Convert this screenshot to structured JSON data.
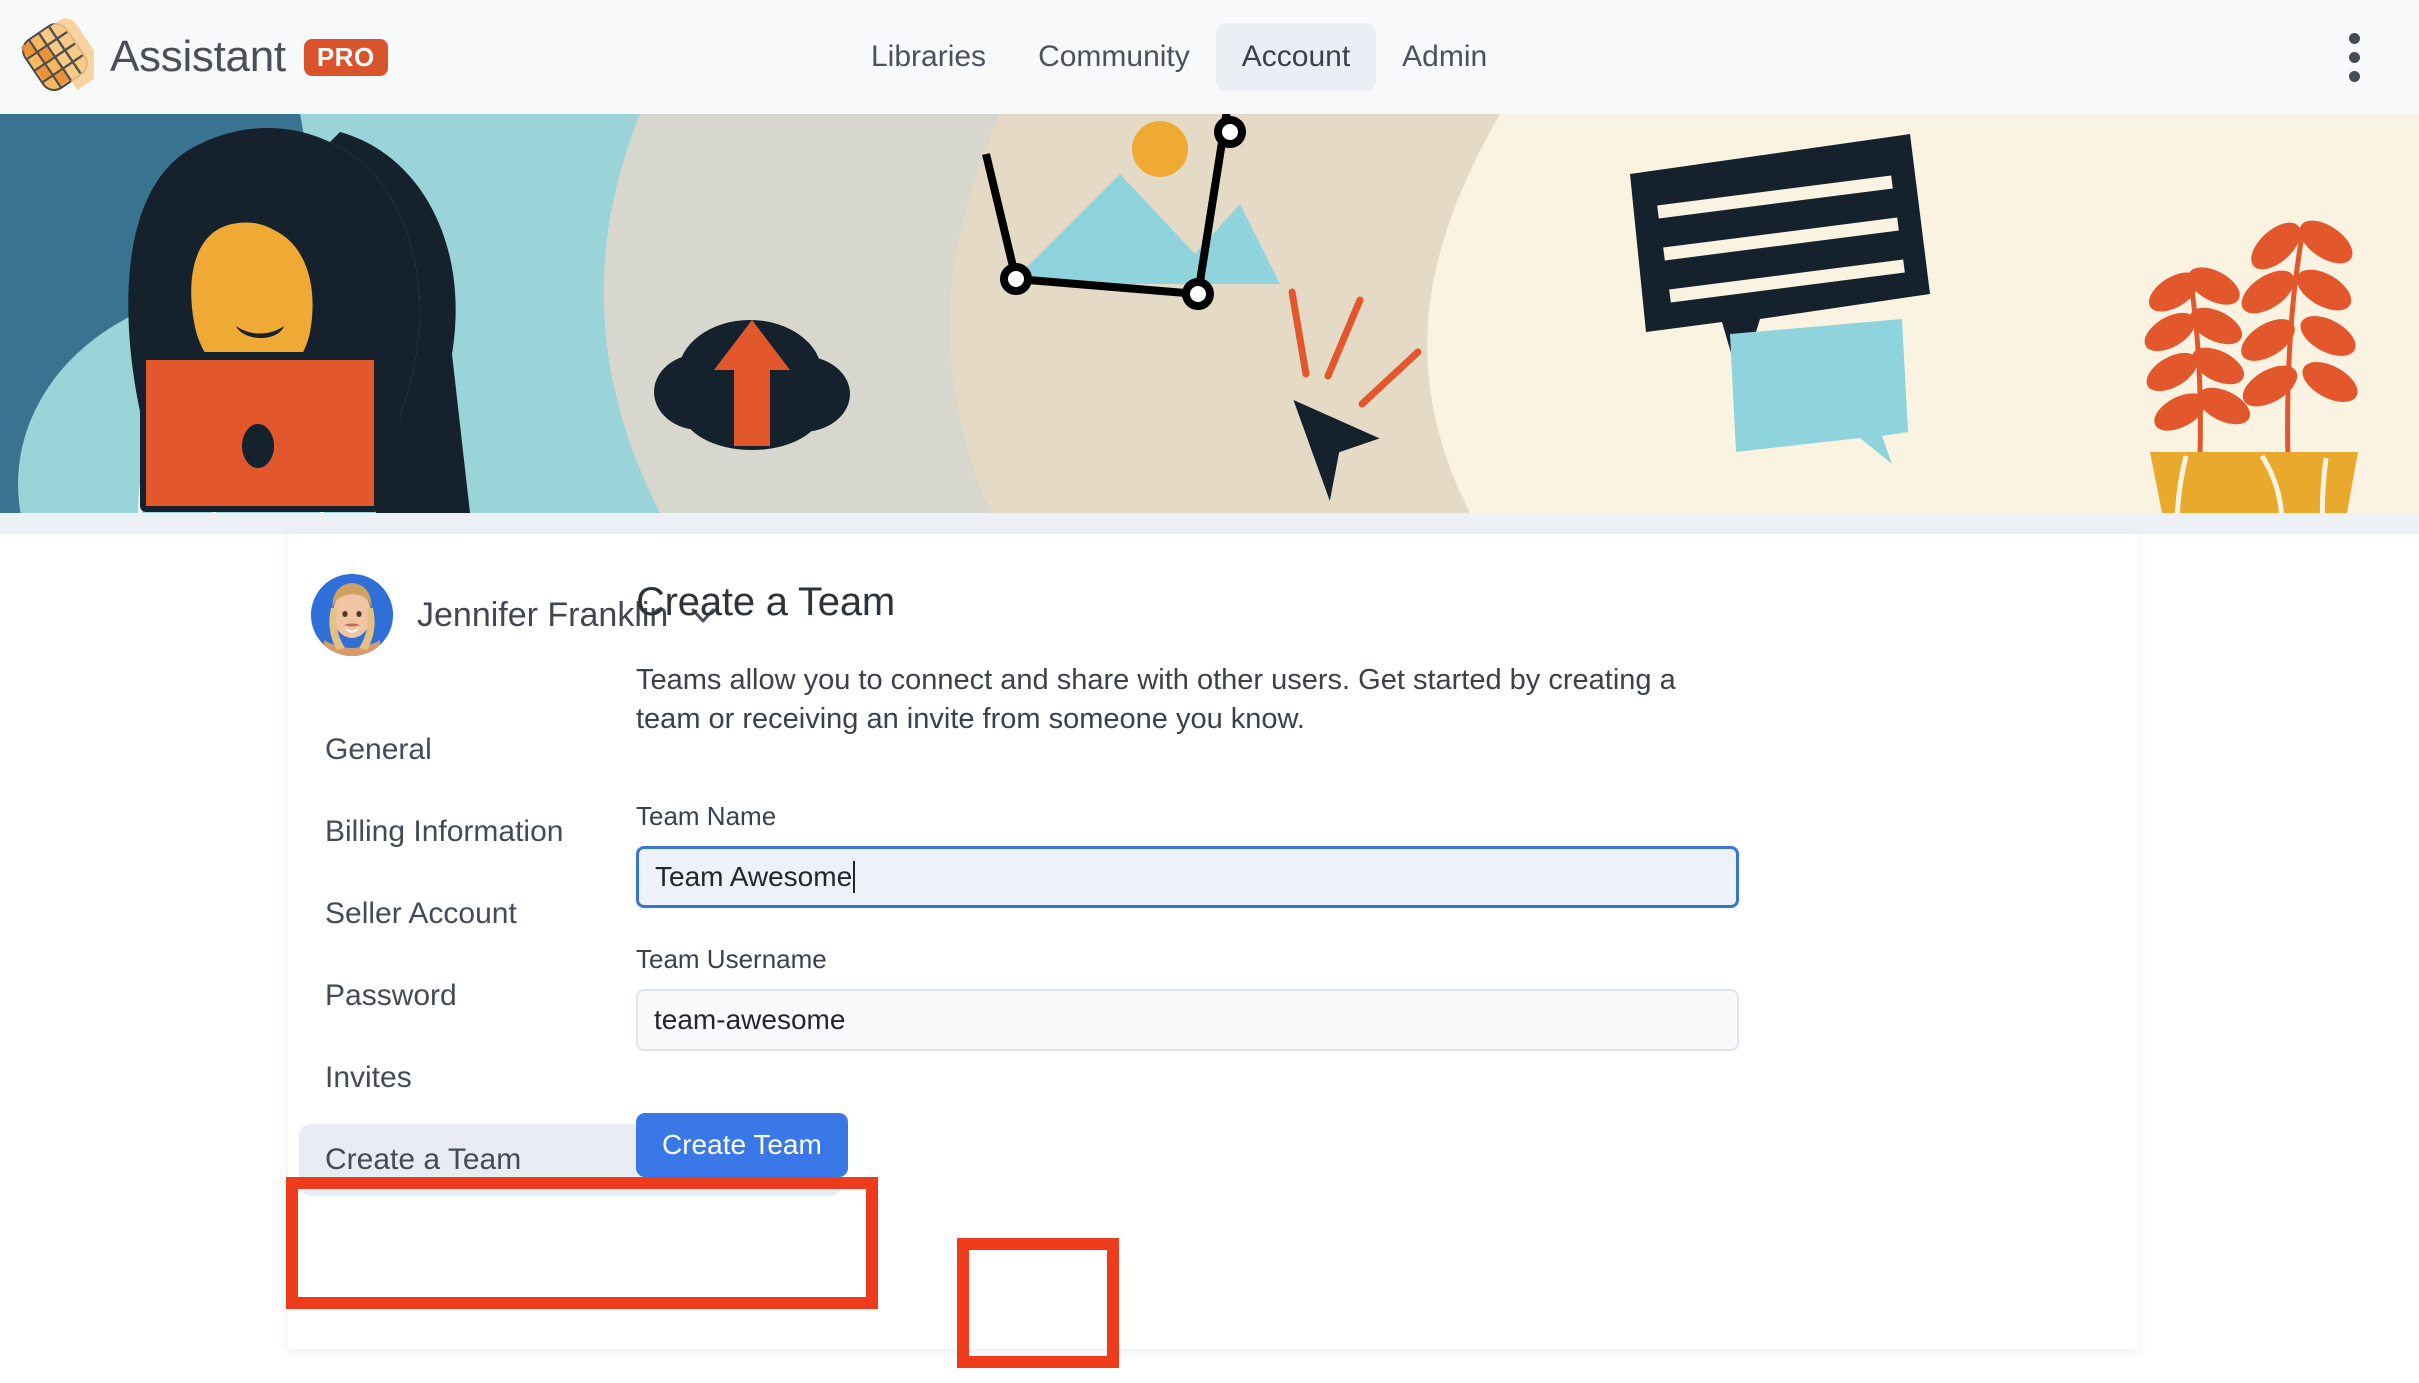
{
  "header": {
    "brand_name": "Assistant",
    "badge": "PRO",
    "logo_icon": "waffle-logo-icon",
    "overflow_icon": "kebab-menu-icon",
    "nav": [
      {
        "label": "Libraries",
        "active": false
      },
      {
        "label": "Community",
        "active": false
      },
      {
        "label": "Account",
        "active": true
      },
      {
        "label": "Admin",
        "active": false
      }
    ]
  },
  "hero": {
    "alt": "illustration-banner-woman-laptop-cloud-image-cursor-chat-plant",
    "colors": {
      "steel_blue": "#3a7390",
      "light_teal": "#9ad4d8",
      "warm_gray": "#d8d7ce",
      "tan": "#e4dac6",
      "cream": "#fbf3e2",
      "orange": "#e2572c",
      "yellow": "#efa935",
      "ink": "#16212e"
    }
  },
  "profile": {
    "name": "Jennifer Franklin",
    "avatar_icon": "user-avatar",
    "dropdown_icon": "chevron-down-icon"
  },
  "sidebar": {
    "items": [
      {
        "label": "General",
        "active": false
      },
      {
        "label": "Billing Information",
        "active": false
      },
      {
        "label": "Seller Account",
        "active": false
      },
      {
        "label": "Password",
        "active": false
      },
      {
        "label": "Invites",
        "active": false
      },
      {
        "label": "Create a Team",
        "active": true
      }
    ]
  },
  "main": {
    "title": "Create a Team",
    "description": "Teams allow you to connect and share with other users. Get started by creating a team or receiving an invite from someone you know.",
    "fields": [
      {
        "label": "Team Name",
        "value": "Team Awesome",
        "placeholder": "Team Name",
        "focused": true
      },
      {
        "label": "Team Username",
        "value": "team-awesome",
        "placeholder": "Team Username",
        "focused": false
      }
    ],
    "submit_label": "Create Team"
  },
  "annotations": {
    "color": "#ee3b1b",
    "boxes": [
      {
        "target": "sidebar-item-create-a-team"
      },
      {
        "target": "create-team-button"
      }
    ]
  },
  "accent_colors": {
    "primary_blue": "#3b78e7",
    "focus_blue": "#3973d4",
    "badge_orange": "#d9532c",
    "annotation_red": "#ee3b1b"
  }
}
